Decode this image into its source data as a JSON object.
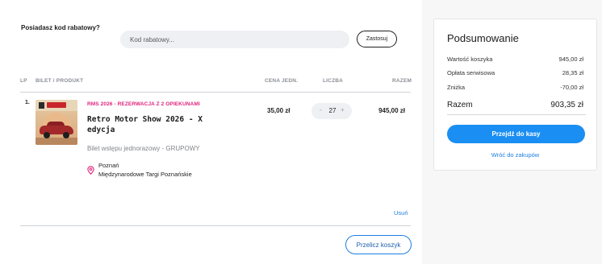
{
  "coupon": {
    "question": "Posiadasz kod rabatowy?",
    "placeholder": "Kod rabatowy...",
    "apply_label": "Zastosuj"
  },
  "table": {
    "headers": {
      "lp": "LP",
      "product": "BILET / PRODUKT",
      "unit_price": "CENA JEDN.",
      "quantity": "LICZBA",
      "total": "RAZEM"
    },
    "rows": [
      {
        "lp": "1.",
        "tag": "RMS 2026 - REZERWACJA Z 2 OPIEKUNAMI",
        "title": "Retro Motor Show 2026 - X edycja",
        "ticket_type": "Bilet wstępu jednorazowy - GRUPOWY",
        "city": "Poznań",
        "venue": "Międzynarodowe Targi Poznańskie",
        "unit_price": "35,00 zł",
        "quantity": "27",
        "minus": "-",
        "plus": "+",
        "total": "945,00 zł",
        "remove_label": "Usuń"
      }
    ]
  },
  "recalc_label": "Przelicz koszyk",
  "summary": {
    "title": "Podsumowanie",
    "cart_value_label": "Wartość koszyka",
    "cart_value": "945,00 zł",
    "service_fee_label": "Opłata serwisowa",
    "service_fee": "28,35 zł",
    "discount_label": "Zniżka",
    "discount": "-70,00 zł",
    "total_label": "Razem",
    "total": "903,35 zł",
    "checkout_label": "Przejdź do kasy",
    "back_label": "Wróć do zakupów"
  },
  "colors": {
    "accent": "#1a8ef3",
    "link": "#1d7fe0",
    "tag": "#e0247a"
  },
  "icons": {
    "location": "map-pin-icon"
  }
}
